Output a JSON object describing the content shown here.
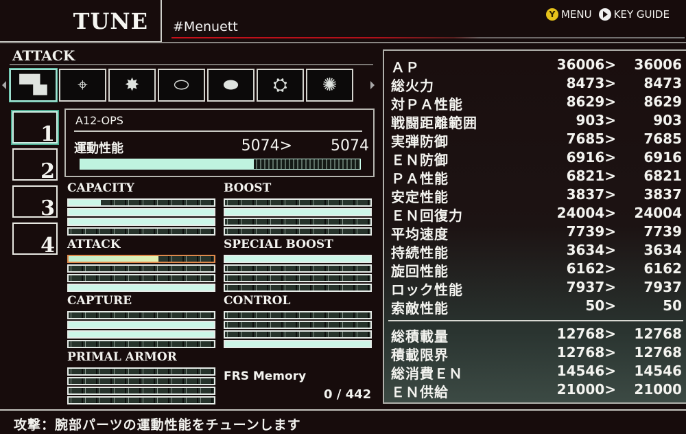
{
  "header": {
    "title": "TUNE",
    "file_name": "#Menuett",
    "hints": [
      {
        "button": "Y",
        "label": "MENU"
      },
      {
        "button": "play",
        "label": "KEY GUIDE"
      }
    ]
  },
  "section": {
    "title": "ATTACK"
  },
  "part_icons": [
    {
      "name": "arm-weapon",
      "glyph": "▀▙",
      "selected": true
    },
    {
      "name": "scope",
      "glyph": "⌖",
      "selected": false
    },
    {
      "name": "explosion",
      "glyph": "✸",
      "selected": false
    },
    {
      "name": "missile",
      "glyph": "⬭",
      "selected": false
    },
    {
      "name": "shell",
      "glyph": "⬬",
      "selected": false
    },
    {
      "name": "mech-leg",
      "glyph": "⛭",
      "selected": false
    },
    {
      "name": "core",
      "glyph": "✺",
      "selected": false
    }
  ],
  "slots": [
    {
      "label": "1",
      "selected": true
    },
    {
      "label": "2",
      "selected": false
    },
    {
      "label": "3",
      "selected": false
    },
    {
      "label": "4",
      "selected": false
    }
  ],
  "part": {
    "name": "A12-OPS",
    "stat_label": "運動性能",
    "before": "5074>",
    "after": "5074",
    "fill_fraction": 0.62
  },
  "tune_groups": [
    {
      "title": "CAPACITY",
      "bars": [
        0.22,
        1.0,
        1.0,
        0.0
      ]
    },
    {
      "title": "BOOST",
      "bars": [
        0.0,
        1.0,
        0.0,
        0.0
      ]
    },
    {
      "title": "ATTACK",
      "bars": [
        0.62,
        0.0,
        0.0,
        1.0
      ],
      "highlight_index": 0
    },
    {
      "title": "SPECIAL BOOST",
      "bars": [
        1.0,
        0.0,
        0.0,
        0.0
      ]
    },
    {
      "title": "CAPTURE",
      "bars": [
        0.0,
        1.0,
        1.0,
        0.0
      ]
    },
    {
      "title": "CONTROL",
      "bars": [
        0.0,
        0.0,
        0.0,
        1.0
      ]
    },
    {
      "title": "PRIMAL ARMOR",
      "bars": [
        0.0,
        0.0,
        0.0,
        0.0
      ]
    }
  ],
  "frs": {
    "label": "FRS Memory",
    "value": "0 / 442"
  },
  "stats": [
    {
      "label": "ＡＰ",
      "before": "36006>",
      "after": "36006"
    },
    {
      "label": "総火力",
      "before": "8473>",
      "after": "8473"
    },
    {
      "label": "対ＰＡ性能",
      "before": "8629>",
      "after": "8629"
    },
    {
      "label": "戦闘距離範囲",
      "before": "903>",
      "after": "903"
    },
    {
      "label": "実弾防御",
      "before": "7685>",
      "after": "7685"
    },
    {
      "label": "ＥＮ防御",
      "before": "6916>",
      "after": "6916"
    },
    {
      "label": "ＰＡ性能",
      "before": "6821>",
      "after": "6821"
    },
    {
      "label": "安定性能",
      "before": "3837>",
      "after": "3837"
    },
    {
      "label": "ＥＮ回復力",
      "before": "24004>",
      "after": "24004"
    },
    {
      "label": "平均速度",
      "before": "7739>",
      "after": "7739"
    },
    {
      "label": "持続性能",
      "before": "3634>",
      "after": "3634"
    },
    {
      "label": "旋回性能",
      "before": "6162>",
      "after": "6162"
    },
    {
      "label": "ロック性能",
      "before": "7937>",
      "after": "7937"
    },
    {
      "label": "索敵性能",
      "before": "50>",
      "after": "50"
    }
  ],
  "load_stats": [
    {
      "label": "総積載量",
      "before": "12768>",
      "after": "12768"
    },
    {
      "label": "積載限界",
      "before": "12768>",
      "after": "12768"
    },
    {
      "label": "総消費ＥＮ",
      "before": "14546>",
      "after": "14546"
    },
    {
      "label": "ＥＮ供給",
      "before": "21000>",
      "after": "21000"
    }
  ],
  "help_text": "攻撃：腕部パーツの運動性能をチューンします"
}
